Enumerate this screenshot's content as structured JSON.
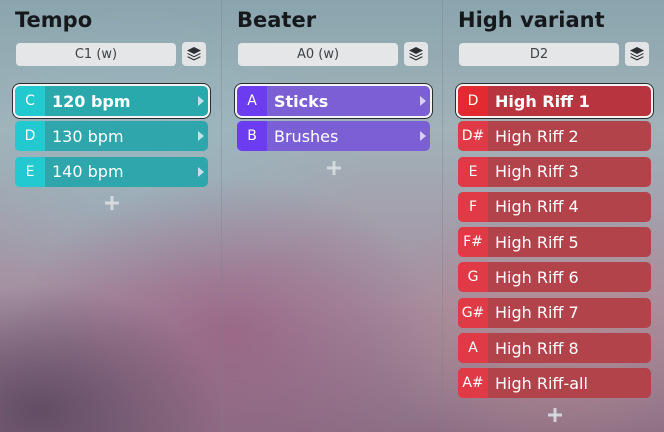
{
  "columns": [
    {
      "title": "Tempo",
      "selector": "C1 (w)",
      "items": [
        {
          "key": "C",
          "label": "120 bpm"
        },
        {
          "key": "D",
          "label": "130 bpm"
        },
        {
          "key": "E",
          "label": "140 bpm"
        }
      ]
    },
    {
      "title": "Beater",
      "selector": "A0 (w)",
      "items": [
        {
          "key": "A",
          "label": "Sticks"
        },
        {
          "key": "B",
          "label": "Brushes"
        }
      ]
    },
    {
      "title": "High variant",
      "selector": "D2",
      "items": [
        {
          "key": "D",
          "label": "High Riff 1"
        },
        {
          "key": "D#",
          "label": "High Riff 2"
        },
        {
          "key": "E",
          "label": "High Riff 3"
        },
        {
          "key": "F",
          "label": "High Riff 4"
        },
        {
          "key": "F#",
          "label": "High Riff 5"
        },
        {
          "key": "G",
          "label": "High Riff 6"
        },
        {
          "key": "G#",
          "label": "High Riff 7"
        },
        {
          "key": "A",
          "label": "High Riff 8"
        },
        {
          "key": "A#",
          "label": "High Riff-all"
        }
      ]
    }
  ],
  "icons": {
    "layers": "layers-icon",
    "add": "plus-icon",
    "arrow": "chevron-right-icon"
  },
  "colors": {
    "tempo_accent": "#22c9cf",
    "beater_accent": "#6b3cf0",
    "riff_accent": "#df3a45"
  }
}
